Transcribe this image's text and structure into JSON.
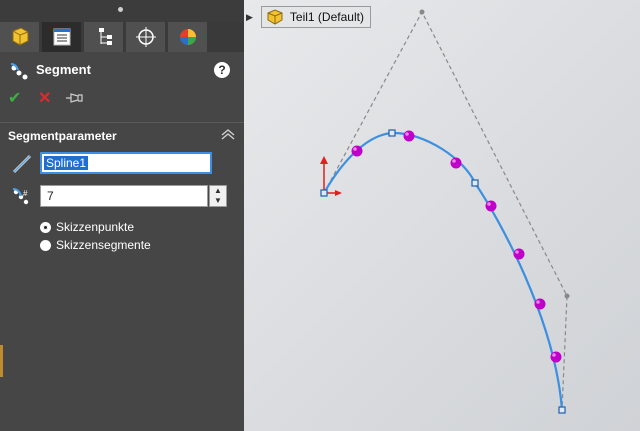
{
  "panel": {
    "tabs": [
      {
        "icon": "feature-manager-icon",
        "active": false
      },
      {
        "icon": "property-manager-icon",
        "active": true
      },
      {
        "icon": "configuration-manager-icon",
        "active": false
      },
      {
        "icon": "dimxpert-icon",
        "active": false
      },
      {
        "icon": "display-manager-icon",
        "active": false
      }
    ],
    "title": "Segment",
    "help_label": "?",
    "section_title": "Segmentparameter",
    "entity_value": "Spline1",
    "count_value": "7",
    "radio_points_label": "Skizzenpunkte",
    "radio_segments_label": "Skizzensegmente",
    "selected_radio": "Skizzenpunkte"
  },
  "tree": {
    "label": "Teil1  (Default)"
  },
  "colors": {
    "panel_bg": "#464646",
    "spline": "#3d8fe0",
    "points": "#c000c8",
    "origin_red": "#e02020",
    "ok_green": "#3cb043",
    "cancel_red": "#e02a2a"
  }
}
